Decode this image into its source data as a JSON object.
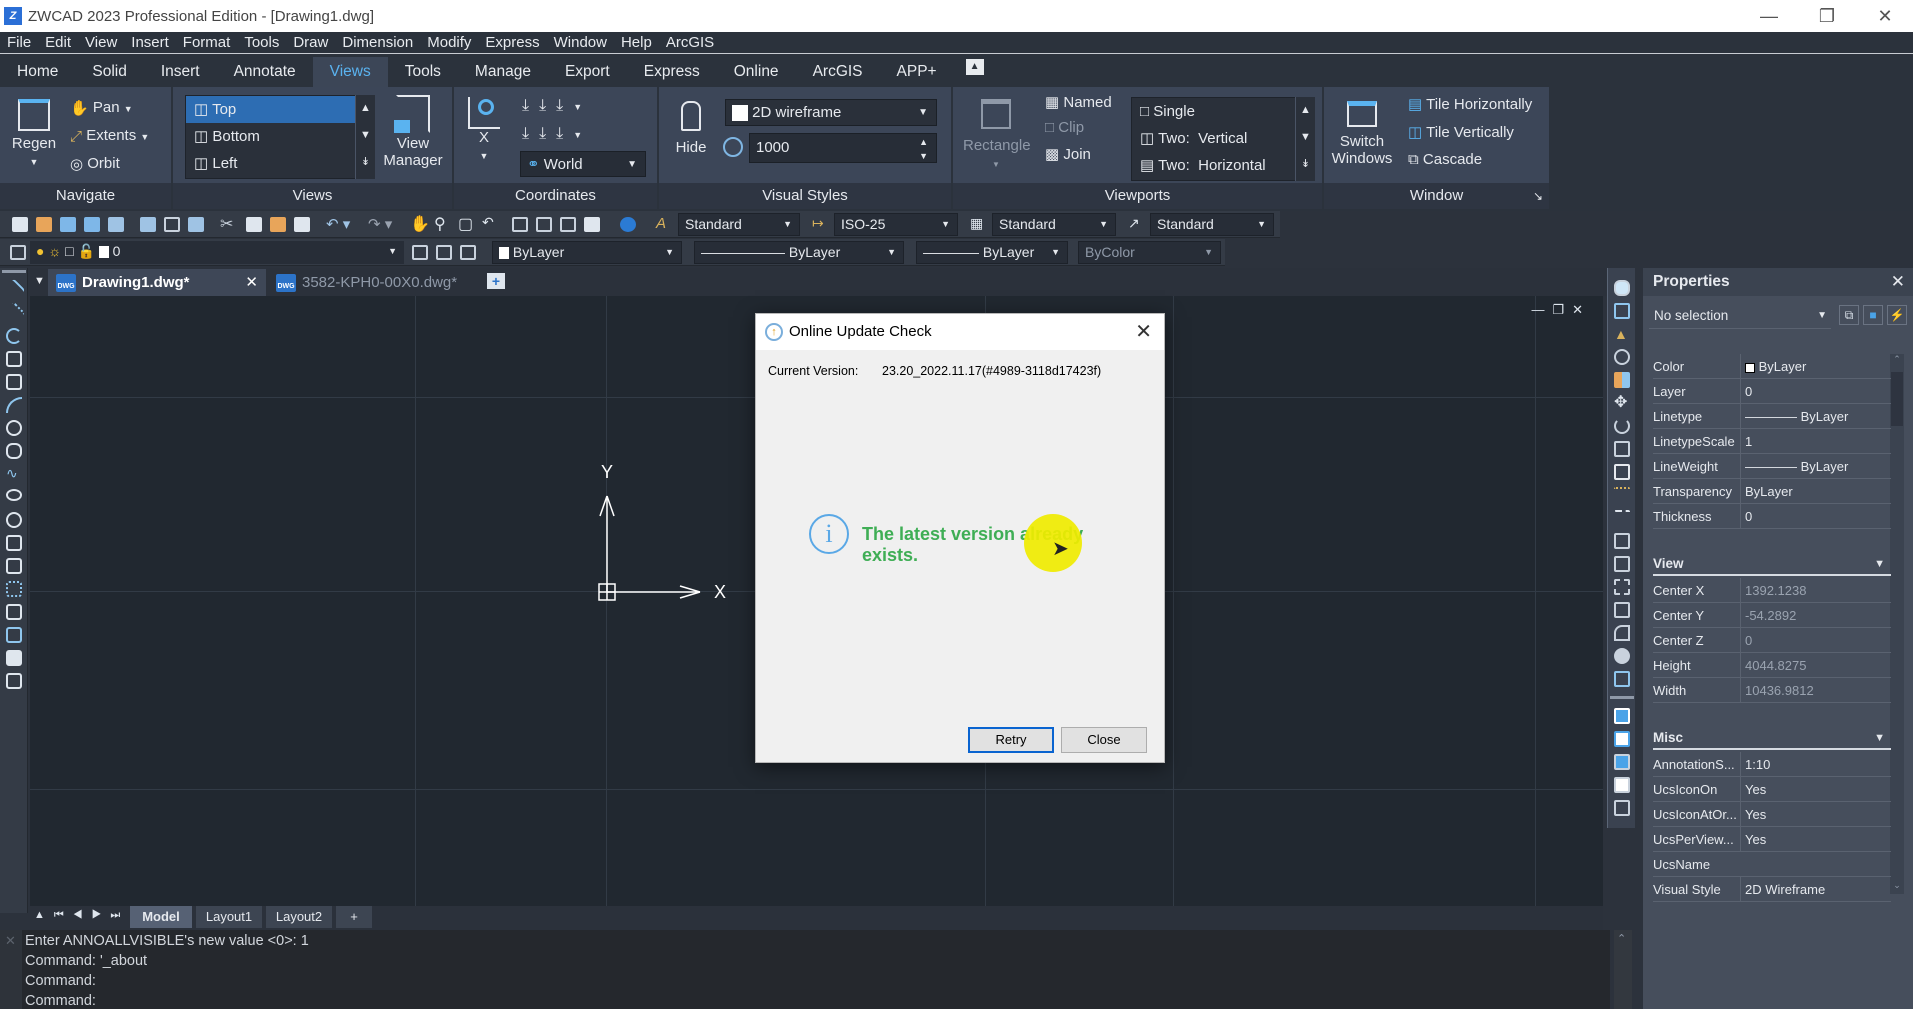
{
  "window": {
    "title": "ZWCAD 2023 Professional Edition - [Drawing1.dwg]",
    "app_icon": "zwcad-logo-icon"
  },
  "menubar": [
    "File",
    "Edit",
    "View",
    "Insert",
    "Format",
    "Tools",
    "Draw",
    "Dimension",
    "Modify",
    "Express",
    "Window",
    "Help",
    "ArcGIS"
  ],
  "ribbon_tabs": [
    "Home",
    "Solid",
    "Insert",
    "Annotate",
    "Views",
    "Tools",
    "Manage",
    "Export",
    "Express",
    "Online",
    "ArcGIS",
    "APP+"
  ],
  "ribbon_active_tab": "Views",
  "ribbon": {
    "navigate": {
      "label": "Navigate",
      "regen": "Regen",
      "pan": "Pan",
      "extents": "Extents",
      "orbit": "Orbit"
    },
    "views": {
      "label": "Views",
      "items": [
        "Top",
        "Bottom",
        "Left"
      ],
      "selected": "Top",
      "view_manager": "View\nManager"
    },
    "coordinates": {
      "label": "Coordinates",
      "x_button": "X",
      "ucs_combo": "World"
    },
    "visual_styles": {
      "label": "Visual Styles",
      "hide": "Hide",
      "style_combo": "2D wireframe",
      "value": "1000"
    },
    "viewports": {
      "label": "Viewports",
      "rectangle": "Rectangle",
      "named": "Named",
      "clip": "Clip",
      "join": "Join",
      "layouts": [
        "Single",
        "Two:  Vertical",
        "Two:  Horizontal"
      ]
    },
    "window": {
      "label": "Window",
      "switch": "Switch\nWindows",
      "tile_h": "Tile Horizontally",
      "tile_v": "Tile Vertically",
      "cascade": "Cascade"
    }
  },
  "toolbar": {
    "text_style": "Standard",
    "dim_style": "ISO-25",
    "table_style": "Standard",
    "mleader_style": "Standard",
    "layer": "0",
    "color": "ByLayer",
    "linetype": "ByLayer",
    "lineweight": "ByLayer",
    "plotstyle": "ByColor"
  },
  "doc_tabs": [
    {
      "label": "Drawing1.dwg*",
      "active": true
    },
    {
      "label": "3582-KPH0-00X0.dwg*",
      "active": false
    }
  ],
  "canvas": {
    "ucs_x": "X",
    "ucs_y": "Y"
  },
  "layout_tabs": [
    "Model",
    "Layout1",
    "Layout2",
    "+"
  ],
  "command_lines": [
    "Enter ANNOALLVISIBLE's new value  <0>: 1",
    "Command: '_about",
    "Command:",
    "Command:"
  ],
  "properties": {
    "title": "Properties",
    "selection": "No selection",
    "general": [
      {
        "k": "Color",
        "v": "ByLayer"
      },
      {
        "k": "Layer",
        "v": "0"
      },
      {
        "k": "Linetype",
        "v": "———— ByLayer"
      },
      {
        "k": "LinetypeScale",
        "v": "1"
      },
      {
        "k": "LineWeight",
        "v": "———— ByLayer"
      },
      {
        "k": "Transparency",
        "v": "ByLayer"
      },
      {
        "k": "Thickness",
        "v": "0"
      }
    ],
    "view_label": "View",
    "view": [
      {
        "k": "Center X",
        "v": "1392.1238"
      },
      {
        "k": "Center Y",
        "v": "-54.2892"
      },
      {
        "k": "Center Z",
        "v": "0"
      },
      {
        "k": "Height",
        "v": "4044.8275"
      },
      {
        "k": "Width",
        "v": "10436.9812"
      }
    ],
    "misc_label": "Misc",
    "misc": [
      {
        "k": "AnnotationS...",
        "v": "1:10"
      },
      {
        "k": "UcsIconOn",
        "v": "Yes"
      },
      {
        "k": "UcsIconAtOr...",
        "v": "Yes"
      },
      {
        "k": "UcsPerView...",
        "v": "Yes"
      },
      {
        "k": "UcsName",
        "v": ""
      },
      {
        "k": "Visual Style",
        "v": "2D Wireframe"
      }
    ]
  },
  "dialog": {
    "title": "Online Update Check",
    "version_label": "Current Version:",
    "version_value": "23.20_2022.11.17(#4989-3118d17423f)",
    "message": "The latest version already exists.",
    "retry": "Retry",
    "close": "Close",
    "message_color": "#3fae55"
  },
  "colors": {
    "accent": "#5ab3f0",
    "selected": "#2d6db3"
  }
}
